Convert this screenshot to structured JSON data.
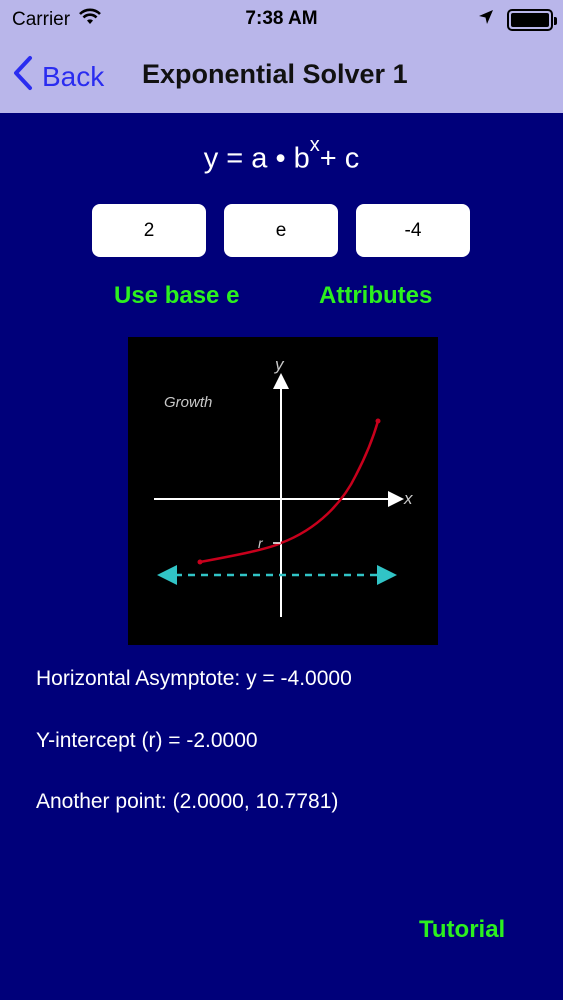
{
  "status_bar": {
    "carrier": "Carrier",
    "time": "7:38 AM",
    "wifi_icon": "wifi-icon",
    "location_icon": "location-arrow-icon",
    "battery_icon": "battery-icon"
  },
  "nav": {
    "back_label": "Back",
    "title": "Exponential Solver 1",
    "back_icon": "chevron-left-icon",
    "accent_color": "#2a2cf0"
  },
  "formula": {
    "base": "y = a • b",
    "exponent": "x",
    "tail": "+ c"
  },
  "inputs": {
    "a": "2",
    "b": "e",
    "c": "-4"
  },
  "buttons": {
    "use_base_e": "Use base e",
    "attributes": "Attributes",
    "tutorial": "Tutorial",
    "color": "#2cf01f"
  },
  "graph": {
    "label": "Growth",
    "y_axis": "y",
    "x_axis": "x",
    "intercept_label": "r",
    "curve_color": "#c8001c",
    "asymptote_color": "#31c4c6"
  },
  "results": {
    "asymptote": "Horizontal Asymptote: y = -4.0000",
    "y_intercept": "Y-intercept (r) = -2.0000",
    "another_point": "Another point: (2.0000, 10.7781)"
  },
  "colors": {
    "background": "#00007a",
    "header": "#b9b6ea"
  }
}
